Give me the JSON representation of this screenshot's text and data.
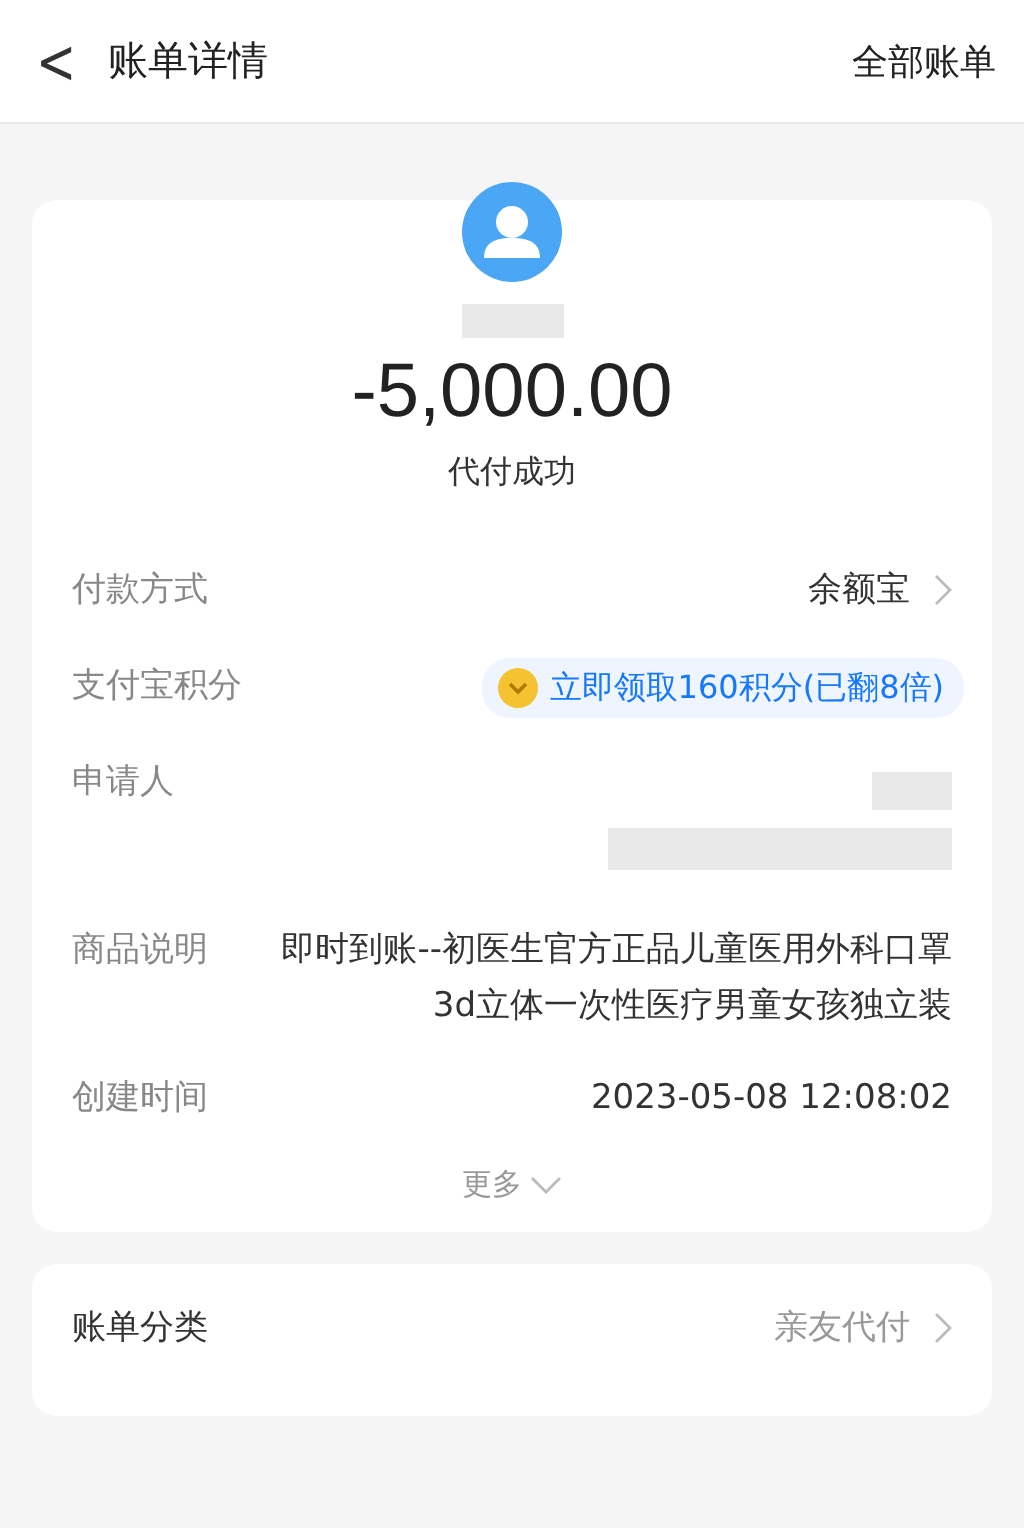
{
  "header": {
    "back": "<",
    "title": "账单详情",
    "action": "全部账单"
  },
  "summary": {
    "amount": "-5,000.00",
    "status": "代付成功"
  },
  "details": [
    {
      "kind": "link",
      "label": "付款方式",
      "value": "余额宝"
    },
    {
      "kind": "points",
      "label": "支付宝积分",
      "value": "立即领取160积分(已翻8倍)"
    },
    {
      "kind": "redacted",
      "label": "申请人"
    },
    {
      "kind": "text",
      "label": "商品说明",
      "value": "即时到账--初医生官方正品儿童医用外科口罩3d立体一次性医疗男童女孩独立装"
    },
    {
      "kind": "text",
      "label": "创建时间",
      "value": "2023-05-08 12:08:02"
    }
  ],
  "more": "更多",
  "category": {
    "label": "账单分类",
    "value": "亲友代付"
  }
}
